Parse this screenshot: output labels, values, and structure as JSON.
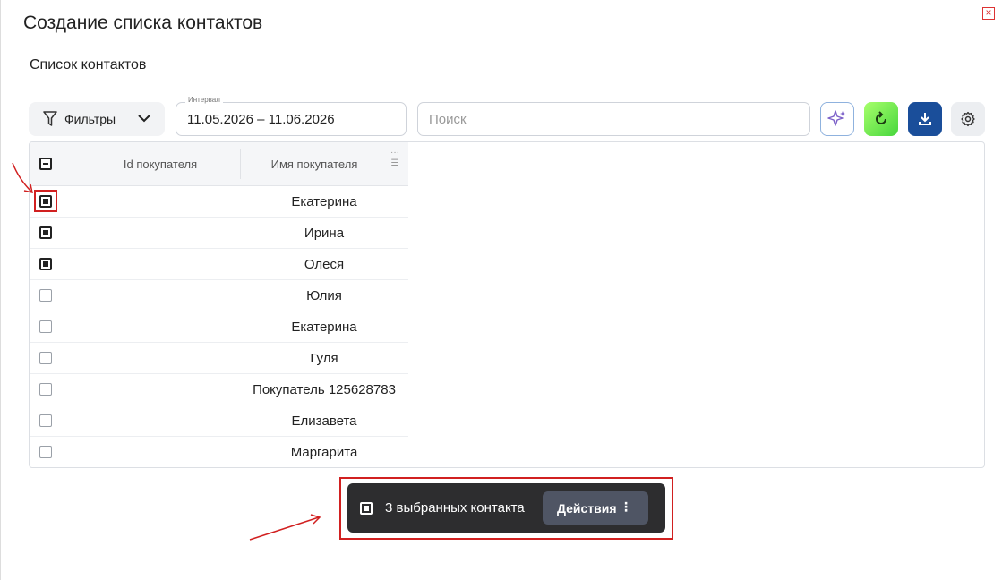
{
  "dialog": {
    "title": "Создание списка контактов",
    "subtitle": "Список контактов",
    "close_icon": "close-icon"
  },
  "toolbar": {
    "filter_label": "Фильтры",
    "interval_legend": "Интервал",
    "interval_value": "11.05.2026 – 11.06.2026",
    "search_placeholder": "Поиск",
    "icons": [
      "sparkle-icon",
      "refresh-icon",
      "download-icon",
      "gear-icon"
    ]
  },
  "table": {
    "columns": [
      "Id покупателя",
      "Имя покупателя"
    ],
    "header_checkbox": "indeterminate",
    "rows": [
      {
        "id": "",
        "name": "Екатерина",
        "checked": true
      },
      {
        "id": "",
        "name": "Ирина",
        "checked": true
      },
      {
        "id": "",
        "name": "Олеся",
        "checked": true
      },
      {
        "id": "",
        "name": "Юлия",
        "checked": false
      },
      {
        "id": "",
        "name": "Екатерина",
        "checked": false
      },
      {
        "id": "",
        "name": "Гуля",
        "checked": false
      },
      {
        "id": "",
        "name": "Покупатель 125628783",
        "checked": false
      },
      {
        "id": "",
        "name": "Елизавета",
        "checked": false
      },
      {
        "id": "",
        "name": "Маргарита",
        "checked": false
      }
    ]
  },
  "selection_bar": {
    "count_text": "3 выбранных контакта",
    "actions_label": "Действия"
  },
  "colors": {
    "annotation": "#d12020",
    "selection_bar_bg": "#2d2d2f",
    "download_btn": "#1a4e9a",
    "refresh_btn": "#47d63d"
  }
}
